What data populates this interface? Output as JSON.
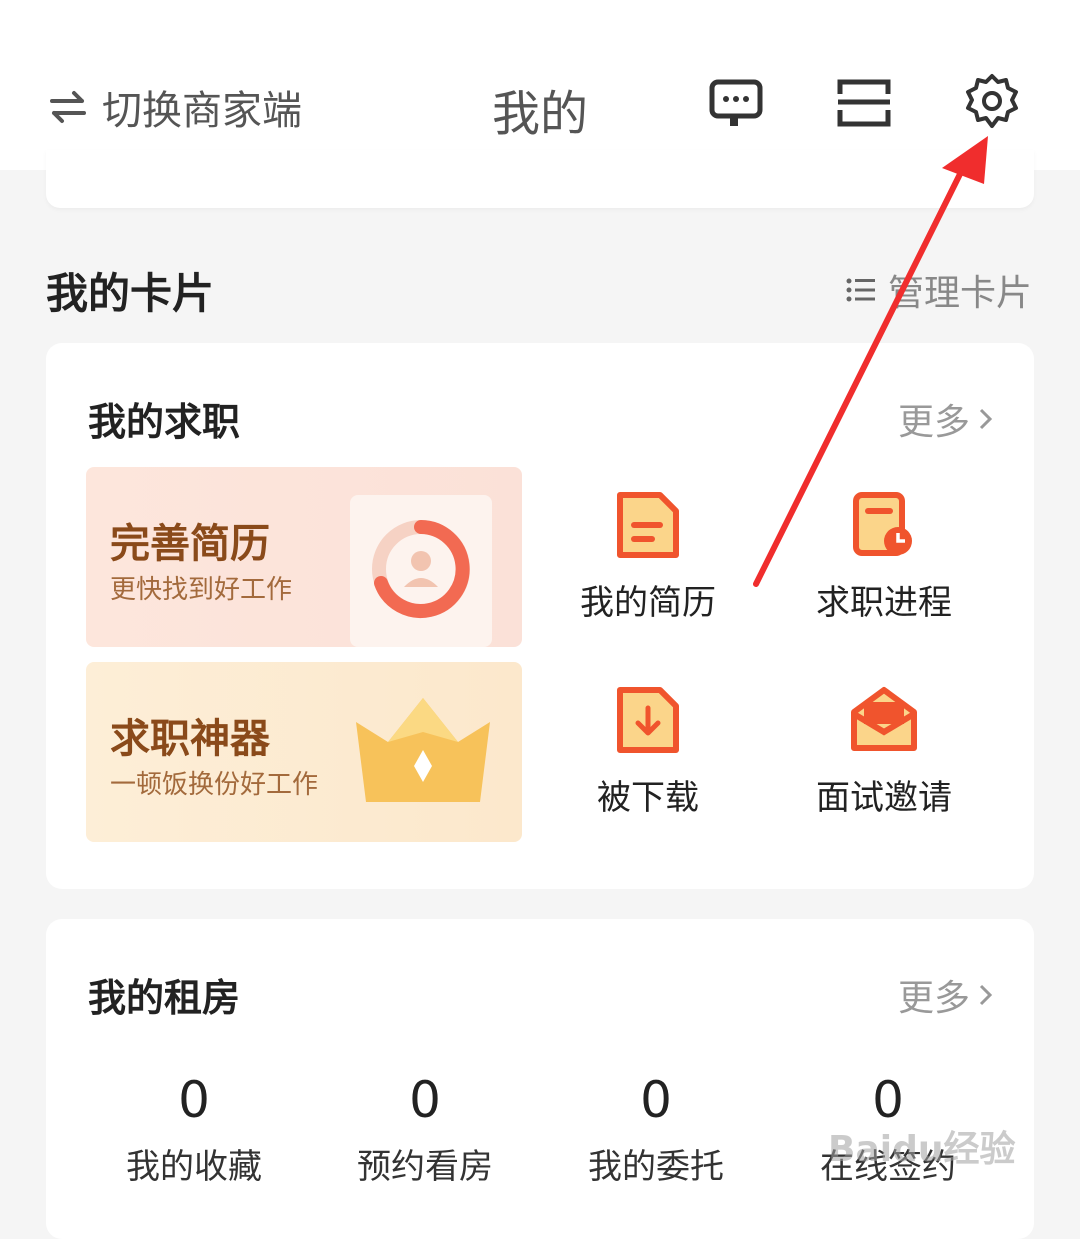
{
  "header": {
    "switch_label": "切换商家端",
    "title": "我的",
    "icons": [
      "customer-service-icon",
      "scan-icon",
      "settings-icon"
    ]
  },
  "cards_section": {
    "title": "我的卡片",
    "manage_label": "管理卡片"
  },
  "job_card": {
    "title": "我的求职",
    "more_label": "更多",
    "promos": [
      {
        "headline": "完善简历",
        "subtitle": "更快找到好工作"
      },
      {
        "headline": "求职神器",
        "subtitle": "一顿饭换份好工作"
      }
    ],
    "items": [
      {
        "label": "我的简历",
        "icon": "resume-icon"
      },
      {
        "label": "求职进程",
        "icon": "progress-icon"
      },
      {
        "label": "被下载",
        "icon": "download-icon"
      },
      {
        "label": "面试邀请",
        "icon": "envelope-icon"
      }
    ]
  },
  "rent_card": {
    "title": "我的租房",
    "more_label": "更多",
    "stats": [
      {
        "value": "0",
        "label": "我的收藏"
      },
      {
        "value": "0",
        "label": "预约看房"
      },
      {
        "value": "0",
        "label": "我的委托"
      },
      {
        "value": "0",
        "label": "在线签约"
      }
    ]
  },
  "watermark": "Baidu经验",
  "colors": {
    "accent": "#f0542d",
    "annotation_arrow": "#f02d2d",
    "promo_text": "#8a4a1a"
  }
}
